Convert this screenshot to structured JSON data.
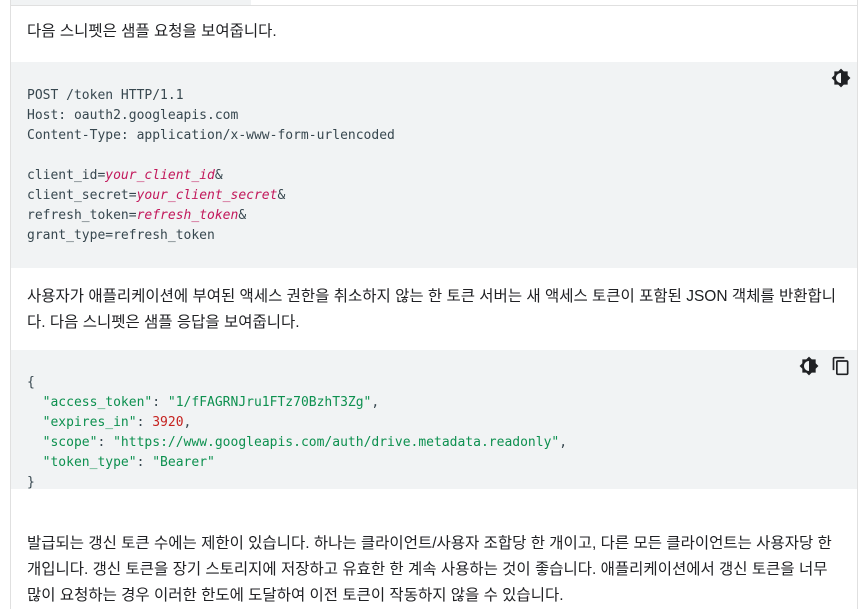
{
  "intro": "다음 스니펫은 샘플 요청을 보여줍니다.",
  "request": {
    "line1": "POST /token HTTP/1.1",
    "line2": "Host: oauth2.googleapis.com",
    "line3": "Content-Type: application/x-www-form-urlencoded",
    "p1_key": "client_id=",
    "p1_val": "your_client_id",
    "p1_amp": "&",
    "p2_key": "client_secret=",
    "p2_val": "your_client_secret",
    "p2_amp": "&",
    "p3_key": "refresh_token=",
    "p3_val": "refresh_token",
    "p3_amp": "&",
    "p4": "grant_type=refresh_token"
  },
  "middle": "사용자가 애플리케이션에 부여된 액세스 권한을 취소하지 않는 한 토큰 서버는 새 액세스 토큰이 포함된 JSON 객체를 반환합니다. 다음 스니펫은 샘플 응답을 보여줍니다.",
  "response": {
    "open": "{",
    "k1": "\"access_token\"",
    "v1": "\"1/fFAGRNJru1FTz70BzhT3Zg\"",
    "k2": "\"expires_in\"",
    "v2": "3920",
    "k3": "\"scope\"",
    "v3": "\"https://www.googleapis.com/auth/drive.metadata.readonly\"",
    "k4": "\"token_type\"",
    "v4": "\"Bearer\"",
    "colon": ": ",
    "comma": ",",
    "close": "}"
  },
  "footer": "발급되는 갱신 토큰 수에는 제한이 있습니다. 하나는 클라이언트/사용자 조합당 한 개이고, 다른 모든 클라이언트는 사용자당 한 개입니다. 갱신 토큰을 장기 스토리지에 저장하고 유효한 한 계속 사용하는 것이 좋습니다. 애플리케이션에서 갱신 토큰을 너무 많이 요청하는 경우 이러한 한도에 도달하여 이전 토큰이 작동하지 않을 수 있습니다.",
  "icons": {
    "theme": "dark-theme-icon",
    "copy": "copy-icon"
  }
}
